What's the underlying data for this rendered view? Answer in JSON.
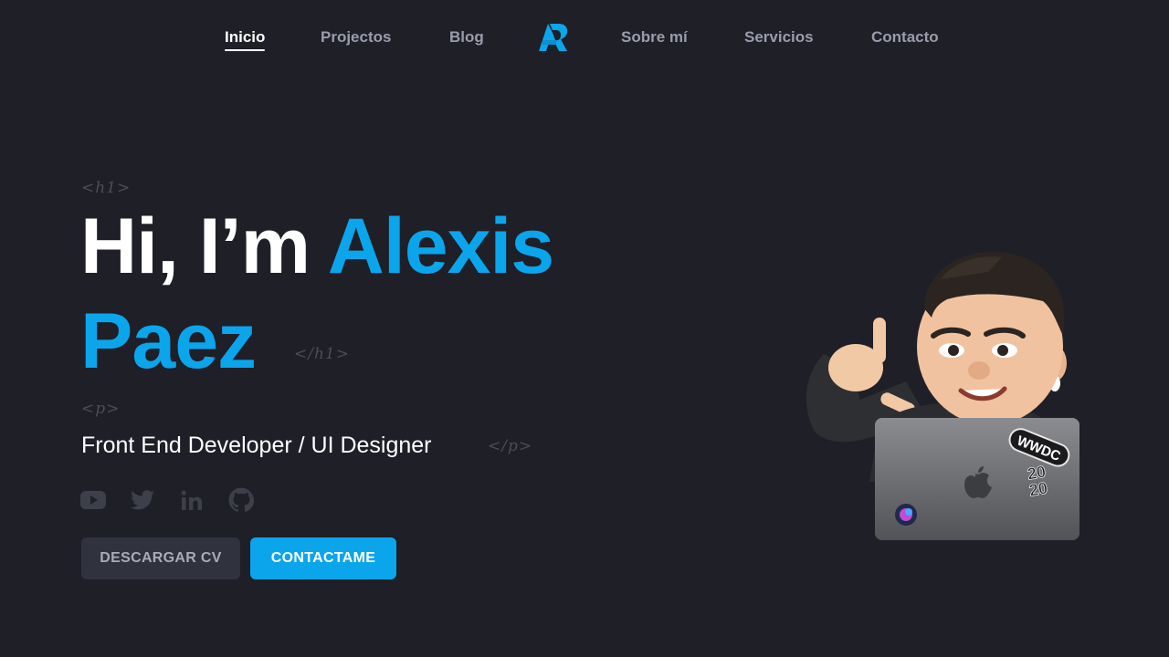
{
  "nav": {
    "items": [
      {
        "label": "Inicio",
        "active": true
      },
      {
        "label": "Projectos",
        "active": false
      },
      {
        "label": "Blog",
        "active": false
      },
      {
        "label": "Sobre mí",
        "active": false
      },
      {
        "label": "Servicios",
        "active": false
      },
      {
        "label": "Contacto",
        "active": false
      }
    ],
    "logo_icon": "ap-logo-icon"
  },
  "hero": {
    "h1_open_tag": "<h1>",
    "h1_close_tag": "</h1>",
    "greeting": "Hi, I’m ",
    "name_first": "Alexis",
    "name_last": "Paez",
    "p_open_tag": "<p>",
    "p_close_tag": "</p>",
    "subtitle": "Front End Developer / UI Designer"
  },
  "socials": [
    {
      "icon": "youtube-icon"
    },
    {
      "icon": "twitter-icon"
    },
    {
      "icon": "linkedin-icon"
    },
    {
      "icon": "github-icon"
    }
  ],
  "buttons": {
    "cv_label": "DESCARGAR CV",
    "contact_label": "CONTACTAME"
  },
  "avatar": {
    "sticker_top": "WWDC",
    "sticker_year_top": "20",
    "sticker_year_bottom": "20"
  },
  "colors": {
    "background": "#1e1f27",
    "accent": "#0ba5ec",
    "muted_text": "#9a9cab",
    "code_tag": "#4b4d5b",
    "button_secondary": "#30323e"
  }
}
